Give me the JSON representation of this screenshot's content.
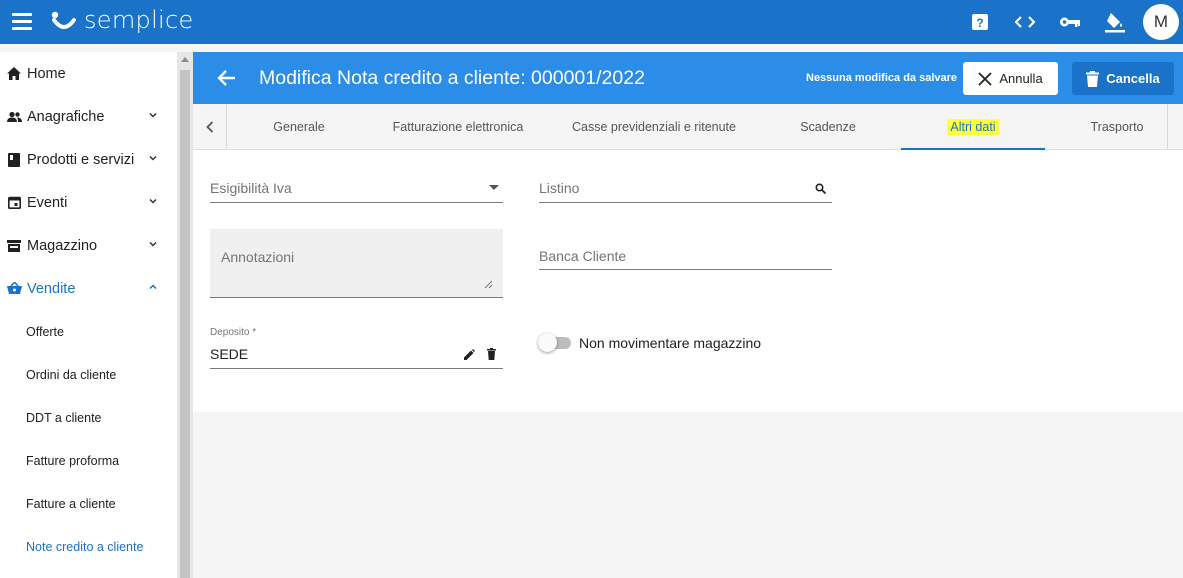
{
  "app": {
    "brand": "semplice",
    "colors": {
      "primary": "#1a73c9",
      "header": "#2b8de8",
      "highlight": "#ffff3a"
    },
    "top_icons": [
      "help-icon",
      "code-icon",
      "key-icon",
      "paint-bucket-icon"
    ],
    "avatar_initial": "M"
  },
  "sidebar": {
    "items": [
      {
        "label": "Home",
        "icon": "home-icon"
      },
      {
        "label": "Anagrafiche",
        "icon": "people-icon"
      },
      {
        "label": "Prodotti e servizi",
        "icon": "book-icon"
      },
      {
        "label": "Eventi",
        "icon": "calendar-icon"
      },
      {
        "label": "Magazzino",
        "icon": "warehouse-icon"
      },
      {
        "label": "Vendite",
        "icon": "basket-icon"
      }
    ],
    "sub_items": [
      {
        "label": "Offerte"
      },
      {
        "label": "Ordini da cliente"
      },
      {
        "label": "DDT a cliente"
      },
      {
        "label": "Fatture proforma"
      },
      {
        "label": "Fatture a cliente"
      },
      {
        "label": "Note credito a cliente"
      }
    ]
  },
  "header": {
    "title": "Modifica Nota credito a cliente: 000001/2022",
    "save_status": "Nessuna modifica da salvare",
    "annulla_label": "Annulla",
    "cancella_label": "Cancella"
  },
  "tabs": [
    {
      "label": "Generale"
    },
    {
      "label": "Fatturazione elettronica"
    },
    {
      "label": "Casse previdenziali e ritenute"
    },
    {
      "label": "Scadenze"
    },
    {
      "label": "Altri dati"
    },
    {
      "label": "Trasporto"
    }
  ],
  "form": {
    "esigibilita_label": "Esigibilità Iva",
    "listino_label": "Listino",
    "annotazioni_label": "Annotazioni",
    "banca_cliente_label": "Banca Cliente",
    "deposito_label": "Deposito *",
    "deposito_value": "SEDE",
    "toggle_label": "Non movimentare magazzino",
    "toggle_on": false
  }
}
